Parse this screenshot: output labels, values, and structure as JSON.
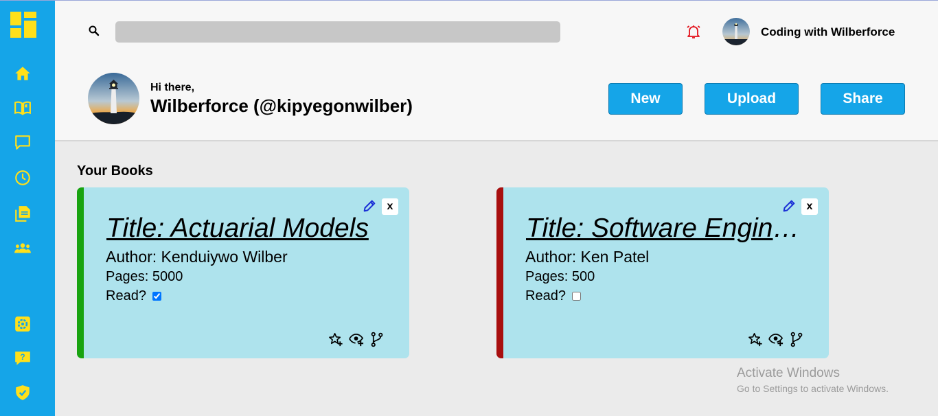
{
  "sidebar": {
    "logo_icon": "dashboard-grid-icon",
    "icon_color": "#ffe01a",
    "background": "#15a5e8",
    "top_items": [
      {
        "name": "home-icon"
      },
      {
        "name": "book-icon"
      },
      {
        "name": "chat-icon"
      },
      {
        "name": "clock-icon"
      },
      {
        "name": "documents-icon"
      },
      {
        "name": "group-icon"
      }
    ],
    "bottom_items": [
      {
        "name": "settings-icon"
      },
      {
        "name": "help-icon"
      },
      {
        "name": "shield-check-icon"
      }
    ]
  },
  "header": {
    "search": {
      "placeholder": "",
      "value": ""
    },
    "notification_icon": "bell-icon",
    "user_name": "Coding with Wilberforce",
    "greeting": "Hi there,",
    "handle": "Wilberforce (@kipyegonwilber)",
    "buttons": {
      "new": "New",
      "upload": "Upload",
      "share": "Share"
    }
  },
  "section_title": "Your Books",
  "books": [
    {
      "title": "Title: Actuarial Models",
      "author": "Author: Kenduiywo Wilber",
      "pages": "Pages: 5000",
      "read_label": "Read?",
      "read": true,
      "accent": "#18a310",
      "close_label": "x"
    },
    {
      "title": "Title: Software Engineering",
      "author": "Author: Ken Patel",
      "pages": "Pages: 500",
      "read_label": "Read?",
      "read": false,
      "accent": "#a80f0f",
      "close_label": "x"
    }
  ],
  "watermark": {
    "title": "Activate Windows",
    "subtitle": "Go to Settings to activate Windows."
  }
}
